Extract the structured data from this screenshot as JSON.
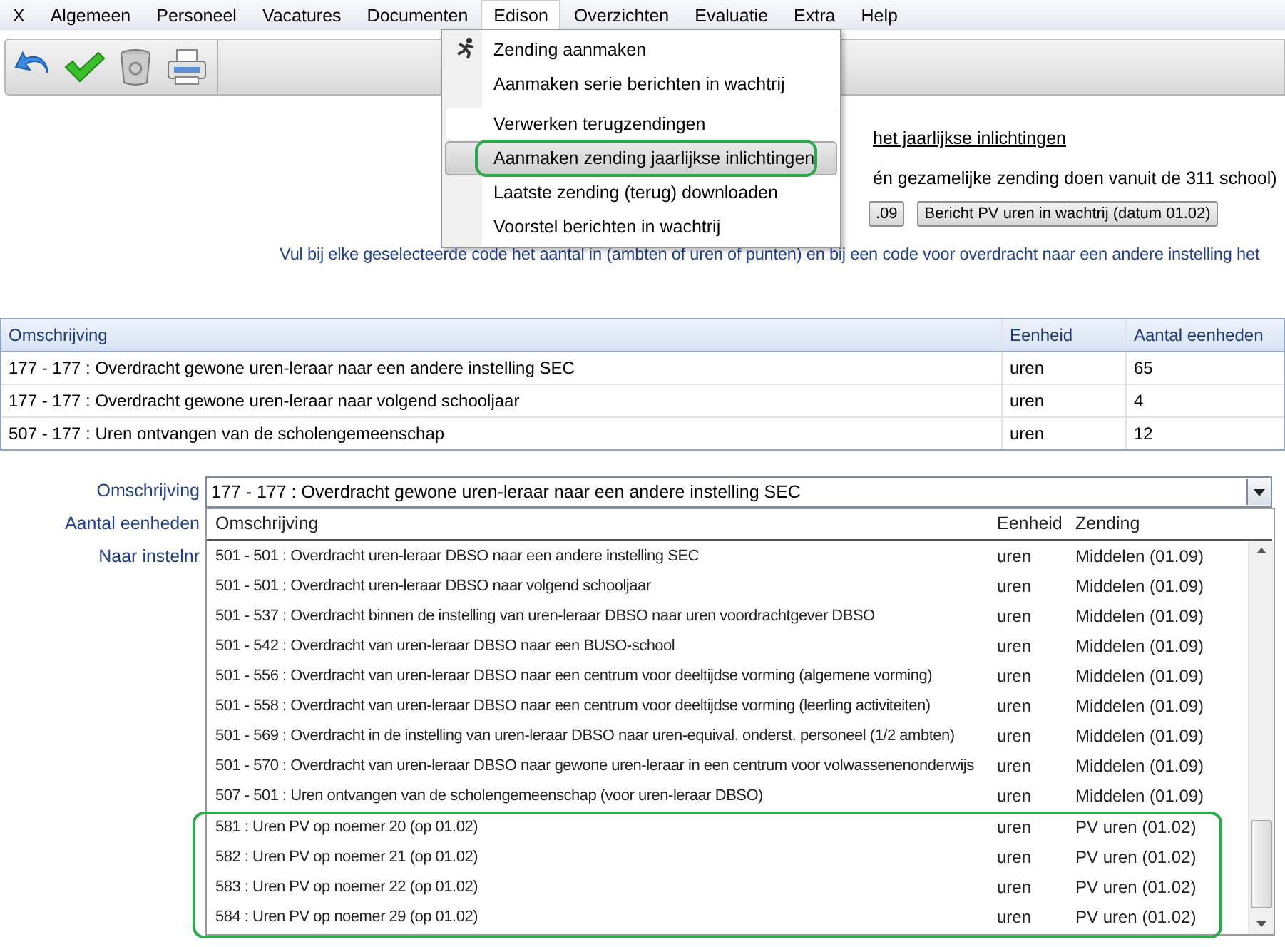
{
  "menubar": {
    "items": [
      {
        "label": "X",
        "selected": false
      },
      {
        "label": "Algemeen",
        "selected": false
      },
      {
        "label": "Personeel",
        "selected": false
      },
      {
        "label": "Vacatures",
        "selected": false
      },
      {
        "label": "Documenten",
        "selected": false
      },
      {
        "label": "Edison",
        "selected": true
      },
      {
        "label": "Overzichten",
        "selected": false
      },
      {
        "label": "Evaluatie",
        "selected": false
      },
      {
        "label": "Extra",
        "selected": false
      },
      {
        "label": "Help",
        "selected": false
      }
    ]
  },
  "edison_menu": {
    "items": [
      {
        "label": "Zending aanmaken",
        "kind": "icon",
        "separator_before": false,
        "selected": false
      },
      {
        "label": "Aanmaken serie berichten in wachtrij",
        "kind": "plain",
        "separator_before": false,
        "selected": false
      },
      {
        "label": "Verwerken terugzendingen",
        "kind": "plain",
        "separator_before": true,
        "selected": false
      },
      {
        "label": "Aanmaken zending jaarlijkse inlichtingen",
        "kind": "plain",
        "separator_before": false,
        "selected": true
      },
      {
        "label": "Laatste zending (terug) downloaden",
        "kind": "plain",
        "separator_before": false,
        "selected": false
      },
      {
        "label": "Voorstel berichten in wachtrij",
        "kind": "plain",
        "separator_before": false,
        "selected": false
      }
    ]
  },
  "info": {
    "link": "het jaarlijkse inlichtingen",
    "note": "én gezamelijke zending doen vanuit de 311 school)",
    "buttons": [
      ".09",
      "Bericht PV uren in wachtrij (datum 01.02)"
    ]
  },
  "instruction": "Vul bij elke geselecteerde code het aantal in (ambten of uren of punten) en bij een code voor overdracht naar een andere instelling het",
  "table": {
    "columns": [
      "Omschrijving",
      "Eenheid",
      "Aantal eenheden"
    ],
    "rows": [
      [
        "177 - 177 : Overdracht gewone uren-leraar naar een andere instelling SEC",
        "uren",
        "65"
      ],
      [
        "177 - 177 : Overdracht gewone uren-leraar naar volgend schooljaar",
        "uren",
        "4"
      ],
      [
        "507 - 177 : Uren ontvangen van de scholengemeenschap",
        "uren",
        "12"
      ]
    ]
  },
  "form": {
    "labels": [
      "Omschrijving",
      "Aantal eenheden",
      "Naar instelnr"
    ],
    "combobox_value": "177 - 177 : Overdracht gewone uren-leraar naar een andere instelling SEC",
    "dropdown": {
      "columns": [
        "Omschrijving",
        "Eenheid",
        "Zending"
      ],
      "rows": [
        {
          "cells": [
            "501 - 501 : Overdracht uren-leraar DBSO naar een andere instelling SEC",
            "uren",
            "Middelen (01.09)"
          ],
          "marked": false
        },
        {
          "cells": [
            "501 - 501 : Overdracht uren-leraar DBSO naar volgend schooljaar",
            "uren",
            "Middelen (01.09)"
          ],
          "marked": false
        },
        {
          "cells": [
            "501 - 537 : Overdracht binnen de instelling van uren-leraar DBSO naar uren voordrachtgever DBSO",
            "uren",
            "Middelen (01.09)"
          ],
          "marked": false
        },
        {
          "cells": [
            "501 - 542 : Overdracht van uren-leraar DBSO naar een BUSO-school",
            "uren",
            "Middelen (01.09)"
          ],
          "marked": false
        },
        {
          "cells": [
            "501 - 556 : Overdracht van uren-leraar DBSO naar een centrum voor deeltijdse vorming (algemene vorming)",
            "uren",
            "Middelen (01.09)"
          ],
          "marked": false
        },
        {
          "cells": [
            "501 - 558 : Overdracht van uren-leraar DBSO naar een centrum voor deeltijdse vorming (leerling activiteiten)",
            "uren",
            "Middelen (01.09)"
          ],
          "marked": false
        },
        {
          "cells": [
            "501 - 569 : Overdracht in de instelling van uren-leraar DBSO naar uren-equival. onderst. personeel (1/2 ambten)",
            "uren",
            "Middelen (01.09)"
          ],
          "marked": false
        },
        {
          "cells": [
            "501 - 570 : Overdracht van uren-leraar DBSO naar gewone uren-leraar in een centrum voor volwassenenonderwijs",
            "uren",
            "Middelen (01.09)"
          ],
          "marked": false
        },
        {
          "cells": [
            "507 - 501 : Uren ontvangen van de scholengemeenschap (voor uren-leraar DBSO)",
            "uren",
            "Middelen (01.09)"
          ],
          "marked": false
        },
        {
          "cells": [
            "581 : Uren PV op noemer 20 (op 01.02)",
            "uren",
            "PV uren (01.02)"
          ],
          "marked": true
        },
        {
          "cells": [
            "582 : Uren PV op noemer 21 (op 01.02)",
            "uren",
            "PV uren (01.02)"
          ],
          "marked": true
        },
        {
          "cells": [
            "583 : Uren PV op noemer 22 (op 01.02)",
            "uren",
            "PV uren (01.02)"
          ],
          "marked": true
        },
        {
          "cells": [
            "584 : Uren PV op noemer 29 (op 01.02)",
            "uren",
            "PV uren (01.02)"
          ],
          "marked": true
        }
      ]
    }
  }
}
